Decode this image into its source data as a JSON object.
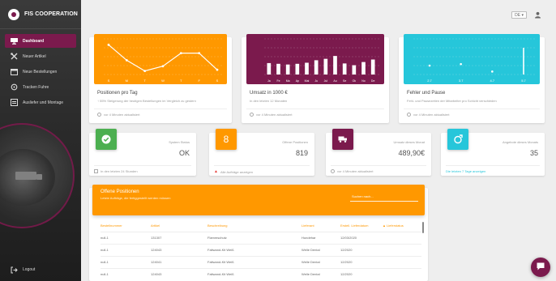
{
  "brand": {
    "name": "FIS COOPERATION"
  },
  "sidebar": {
    "items": [
      {
        "label": "Dashboard",
        "icon": "dashboard-icon",
        "active": true
      },
      {
        "label": "Neuer Artikel",
        "icon": "tools-icon",
        "active": false
      },
      {
        "label": "Neue Bestellungen",
        "icon": "calendar-icon",
        "active": false
      },
      {
        "label": "Tracken Fuhre",
        "icon": "refresh-icon",
        "active": false
      },
      {
        "label": "Ausliefer und Montage",
        "icon": "truck-icon",
        "active": false
      }
    ],
    "logout": "Logout"
  },
  "topbar": {
    "language": "DE ▾",
    "user_icon": "person-icon"
  },
  "charts": [
    {
      "title": "Positionen pro Tag",
      "subtitle": "↑ 55% Steigerung der heutigen Bestellungen im Vergleich zu gestern",
      "footer": "vor 4 Minuten aktualisiert",
      "color": "#ff9800"
    },
    {
      "title": "Umsatz in 1000 €",
      "subtitle": "In den letzten 12 Monaten",
      "footer": "vor 4 Minuten aktualisiert",
      "color": "#7b1a4d"
    },
    {
      "title": "Fehler und Pause",
      "subtitle": "Fehl- und Pausezeiten der Mitarbeiter pro Schicht verschieden",
      "footer": "vor 4 Minuten aktualisiert",
      "color": "#26c6da"
    }
  ],
  "chart_data": [
    {
      "type": "line",
      "x": [
        "S",
        "M",
        "T",
        "W",
        "T",
        "F",
        "S"
      ],
      "values": [
        25,
        12,
        3,
        7,
        18,
        18,
        4
      ],
      "ylim": [
        0,
        30
      ]
    },
    {
      "type": "bar",
      "categories": [
        "Ja",
        "Fe",
        "Ma",
        "Ap",
        "Mai",
        "Ju",
        "Jul",
        "Au",
        "Se",
        "Ok",
        "No",
        "De"
      ],
      "values": [
        320,
        300,
        280,
        300,
        330,
        400,
        440,
        520,
        310,
        260,
        350,
        420
      ],
      "ylim": [
        0,
        1000
      ]
    },
    {
      "type": "scatter",
      "x": [
        "2.7",
        "3.7",
        "4.7",
        "5.7"
      ],
      "values": [
        6,
        7,
        2,
        18
      ],
      "ylim": [
        0,
        24
      ]
    }
  ],
  "stats": [
    {
      "label": "System Status",
      "value": "OK",
      "footer": "In den letzten 24 Stunden",
      "color": "#4caf50",
      "icon": "check-icon"
    },
    {
      "label": "Offene Positionen",
      "value": "819",
      "footer": "Alle Aufträge anzeigen",
      "color": "#ff9800",
      "icon": "number-icon",
      "icon_text": "8"
    },
    {
      "label": "Umsatz dieses Monat",
      "value": "489,90€",
      "footer": "vor 4 Minuten aktualisiert",
      "color": "#7b1a4d",
      "icon": "truck-icon"
    },
    {
      "label": "Angebote dieses Monats",
      "value": "35",
      "footer": "Die letzten 7 Tage anzeigen",
      "color": "#26c6da",
      "icon": "rocket-icon"
    }
  ],
  "orders": {
    "title": "Offene Positionen",
    "subtitle": "Letzte Aufträge, die fertiggestellt werden müssen",
    "search_placeholder": "Suchen nach...",
    "columns": [
      "Bestellnummer",
      "Artikel",
      "Beschreibung",
      "Lieferant",
      "Erstell. Lieferdatum",
      "▲ Lieferstatus"
    ],
    "rows": [
      [
        "null-1",
        "131307",
        "Flammschutz",
        "Hundehar",
        "12/03/2020"
      ],
      [
        "null-1",
        "124043",
        "Faltwand-Kit Weiß",
        "Welle Dental",
        "12/2020"
      ],
      [
        "null-1",
        "124041",
        "Faltwand-Kit Weiß",
        "Welle Dental",
        "12/2020"
      ],
      [
        "null-1",
        "124043",
        "Faltwand-Kit Weiß",
        "Welle Dental",
        "12/2020"
      ]
    ]
  },
  "chat": {
    "icon": "chat-icon"
  }
}
